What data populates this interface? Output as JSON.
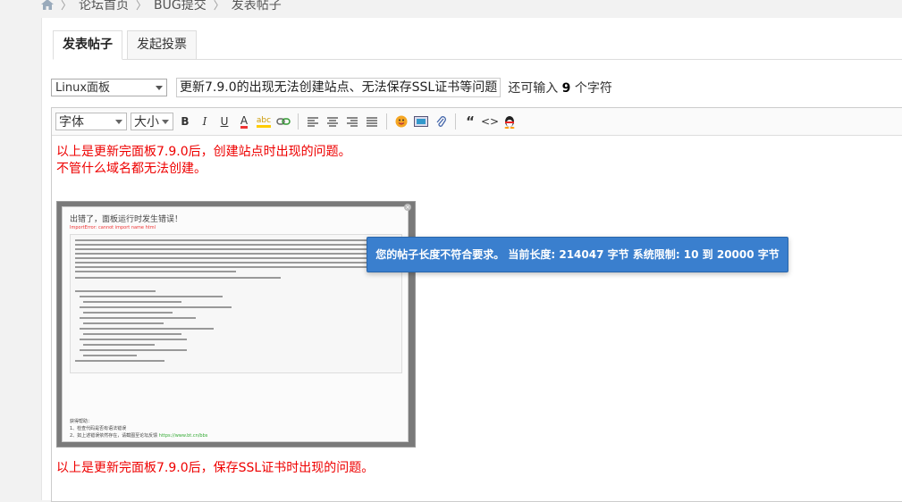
{
  "breadcrumb": {
    "items": [
      "论坛首页",
      "BUG提交",
      "发表帖子"
    ]
  },
  "tabs": [
    {
      "label": "发表帖子"
    },
    {
      "label": "发起投票"
    }
  ],
  "title_row": {
    "category": "Linux面板",
    "title": "更新7.9.0的出现无法创建站点、无法保存SSL证书等问题",
    "remain_prefix": "还可输入",
    "remain_count": "9",
    "remain_suffix": "个字符"
  },
  "toolbar": {
    "font_select": "字体",
    "size_select": "大小",
    "icons": [
      "bold-icon",
      "italic-icon",
      "underline-icon",
      "font-color-icon",
      "background-color-icon",
      "link-icon",
      "align-left-icon",
      "align-center-icon",
      "align-right-icon",
      "align-justify-icon",
      "emoji-icon",
      "image-icon",
      "attachment-icon",
      "quote-icon",
      "code-icon",
      "qq-icon"
    ]
  },
  "content": {
    "line1": "以上是更新完面板7.9.0后，创建站点时出现的问题。",
    "line2": "不管什么域名都无法创建。",
    "line3": "以上是更新完面板7.9.0后，保存SSL证书时出现的问题。",
    "screenshot": {
      "title": "出错了，面板运行时发生错误！",
      "error": "ImportError: cannot import name html",
      "footer1": "获得帮助：",
      "footer2": "1、检查代码是否有语法错误",
      "footer3": "2、如上述错误依然存在，请截图至论坛反馈",
      "footer4": "https://www.bt.cn/bbs"
    }
  },
  "toast": {
    "text": "您的帖子长度不符合要求。 当前长度: 214047 字节 系统限制: 10 到 20000 字节"
  },
  "colors": {
    "red_text": "#e00000",
    "toast_bg": "#3a7fce"
  }
}
